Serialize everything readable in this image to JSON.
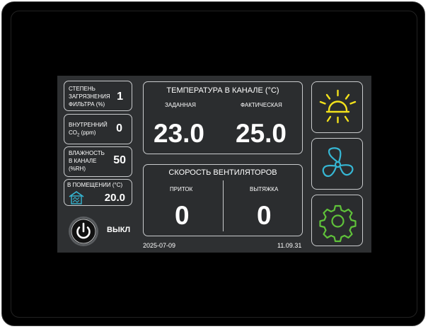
{
  "filter": {
    "label_1": "СТЕПЕНЬ",
    "label_2": "ЗАГРЯЗНЕНИЯ",
    "label_3": "ФИЛЬТРА (%)",
    "value": "1"
  },
  "co2": {
    "label_1": "ВНУТРЕННИЙ",
    "label_2": "CO",
    "label_sub": "2",
    "label_3": "(ppm)",
    "value": "0"
  },
  "humidity": {
    "label_1": "ВЛАЖНОСТЬ",
    "label_2": "В КАНАЛЕ",
    "label_3": "(%RH)",
    "value": "50"
  },
  "room": {
    "label": "В ПОМЕЩЕНИИ (°C)",
    "value": "20.0"
  },
  "power": {
    "label": "ВЫКЛ"
  },
  "temperature": {
    "title": "ТЕМПЕРАТУРА В КАНАЛЕ (°C)",
    "set_label": "ЗАДАННАЯ",
    "set_value": "23.0",
    "actual_label": "ФАКТИЧЕСКАЯ",
    "actual_value": "25.0"
  },
  "fans": {
    "title": "СКОРОСТЬ ВЕНТИЛЯТОРОВ",
    "supply_label": "ПРИТОК",
    "supply_value": "0",
    "exhaust_label": "ВЫТЯЖКА",
    "exhaust_value": "0"
  },
  "footer": {
    "date": "2025-07-09",
    "time": "11.09.31"
  },
  "colors": {
    "sun": "#f2e11b",
    "fan": "#36b7d4",
    "gear": "#5fc23a"
  },
  "icons": {
    "mode": "sun-icon",
    "fan": "fan-icon",
    "settings": "gear-icon",
    "room": "house-icon",
    "power": "power-icon"
  }
}
